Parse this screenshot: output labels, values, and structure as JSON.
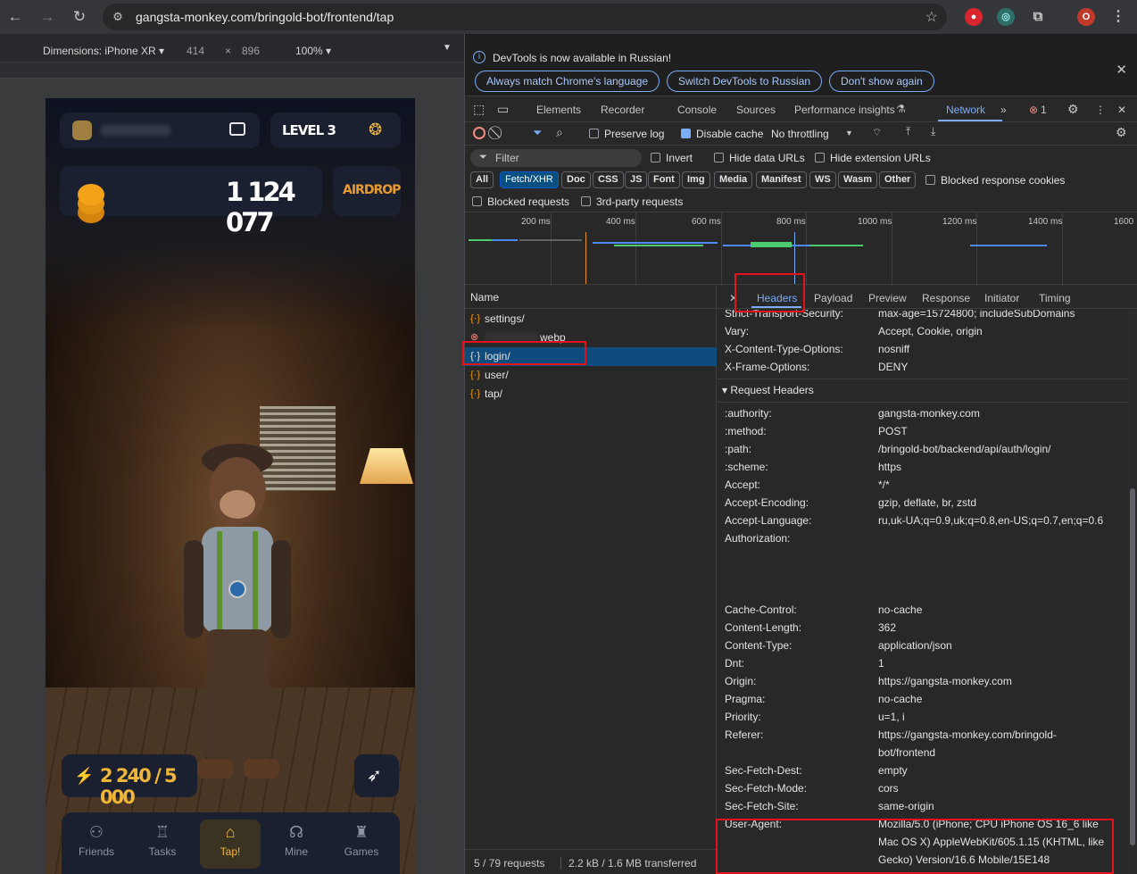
{
  "browser": {
    "url": "gangsta-monkey.com/bringold-bot/frontend/tap",
    "profile_initial": "O"
  },
  "device_toolbar": {
    "dimensions_label": "Dimensions: iPhone XR ▾",
    "width": "414",
    "times": "×",
    "height": "896",
    "zoom": "100% ▾"
  },
  "game": {
    "level": "LEVEL 3",
    "balance": "1 124 077",
    "airdrop_label": "AIRDROP",
    "energy": "2 240 / 5 000",
    "nav": [
      {
        "label": "Friends",
        "icon": "friends-icon"
      },
      {
        "label": "Tasks",
        "icon": "tasks-icon"
      },
      {
        "label": "Tap!",
        "icon": "tap-icon"
      },
      {
        "label": "Mine",
        "icon": "mine-icon"
      },
      {
        "label": "Games",
        "icon": "games-icon"
      }
    ]
  },
  "devtools": {
    "info_text": "DevTools is now available in Russian!",
    "info_buttons": [
      "Always match Chrome's language",
      "Switch DevTools to Russian",
      "Don't show again"
    ],
    "tabs": [
      "Elements",
      "Recorder",
      "Console",
      "Sources",
      "Performance insights",
      "Network"
    ],
    "active_tab": "Network",
    "error_count": "1",
    "toolbar": {
      "preserve_log": "Preserve log",
      "disable_cache": "Disable cache",
      "throttling": "No throttling"
    },
    "filter": {
      "placeholder": "Filter",
      "invert": "Invert",
      "hide_data_urls": "Hide data URLs",
      "hide_extension_urls": "Hide extension URLs",
      "types": [
        "All",
        "Fetch/XHR",
        "Doc",
        "CSS",
        "JS",
        "Font",
        "Img",
        "Media",
        "Manifest",
        "WS",
        "Wasm",
        "Other"
      ],
      "active_type": "Fetch/XHR",
      "blocked_response_cookies": "Blocked response cookies",
      "blocked_requests": "Blocked requests",
      "third_party": "3rd-party requests"
    },
    "timeline_labels": [
      "200 ms",
      "400 ms",
      "600 ms",
      "800 ms",
      "1000 ms",
      "1200 ms",
      "1400 ms",
      "1600"
    ],
    "requests_header": "Name",
    "requests": [
      {
        "name": "settings/",
        "status": "ok"
      },
      {
        "name": "webp",
        "status": "error"
      },
      {
        "name": "login/",
        "status": "ok",
        "selected": true
      },
      {
        "name": "user/",
        "status": "ok"
      },
      {
        "name": "tap/",
        "status": "ok"
      }
    ],
    "detail_tabs": [
      "Headers",
      "Payload",
      "Preview",
      "Response",
      "Initiator",
      "Timing"
    ],
    "response_headers": [
      {
        "key": "Strict-Transport-Security:",
        "value": "max-age=15724800; includeSubDomains"
      },
      {
        "key": "Vary:",
        "value": "Accept, Cookie, origin"
      },
      {
        "key": "X-Content-Type-Options:",
        "value": "nosniff"
      },
      {
        "key": "X-Frame-Options:",
        "value": "DENY"
      }
    ],
    "request_headers_title": "▾ Request Headers",
    "request_headers": [
      {
        "key": ":authority:",
        "value": "gangsta-monkey.com"
      },
      {
        "key": ":method:",
        "value": "POST"
      },
      {
        "key": ":path:",
        "value": "/bringold-bot/backend/api/auth/login/"
      },
      {
        "key": ":scheme:",
        "value": "https"
      },
      {
        "key": "Accept:",
        "value": "*/*"
      },
      {
        "key": "Accept-Encoding:",
        "value": "gzip, deflate, br, zstd"
      },
      {
        "key": "Accept-Language:",
        "value": "ru,uk-UA;q=0.9,uk;q=0.8,en-US;q=0.7,en;q=0.6"
      },
      {
        "key": "Authorization:",
        "value": ""
      },
      {
        "key": "Cache-Control:",
        "value": "no-cache"
      },
      {
        "key": "Content-Length:",
        "value": "362"
      },
      {
        "key": "Content-Type:",
        "value": "application/json"
      },
      {
        "key": "Dnt:",
        "value": "1"
      },
      {
        "key": "Origin:",
        "value": "https://gangsta-monkey.com"
      },
      {
        "key": "Pragma:",
        "value": "no-cache"
      },
      {
        "key": "Priority:",
        "value": "u=1, i"
      },
      {
        "key": "Referer:",
        "value": "https://gangsta-monkey.com/bringold-bot/frontend"
      },
      {
        "key": "Sec-Fetch-Dest:",
        "value": "empty"
      },
      {
        "key": "Sec-Fetch-Mode:",
        "value": "cors"
      },
      {
        "key": "Sec-Fetch-Site:",
        "value": "same-origin"
      },
      {
        "key": "User-Agent:",
        "value": "Mozilla/5.0 (iPhone; CPU iPhone OS 16_6 like Mac OS X) AppleWebKit/605.1.15 (KHTML, like Gecko) Version/16.6 Mobile/15E148 Safari/604.1"
      }
    ],
    "status": {
      "requests": "5 / 79 requests",
      "transferred": "2.2 kB / 1.6 MB transferred"
    }
  }
}
